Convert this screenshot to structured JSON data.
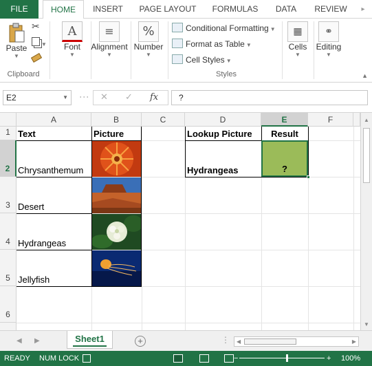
{
  "ribbon_tabs": [
    "FILE",
    "HOME",
    "INSERT",
    "PAGE LAYOUT",
    "FORMULAS",
    "DATA",
    "REVIEW"
  ],
  "ribbon": {
    "clipboard": {
      "paste": "Paste",
      "label": "Clipboard"
    },
    "font": {
      "label": "Font"
    },
    "alignment": {
      "label": "Alignment"
    },
    "number": {
      "label": "Number"
    },
    "styles": {
      "conditional": "Conditional Formatting",
      "format_table": "Format as Table",
      "cell_styles": "Cell Styles",
      "label": "Styles"
    },
    "cells": {
      "label": "Cells"
    },
    "editing": {
      "label": "Editing"
    }
  },
  "formula_bar": {
    "name_box": "E2",
    "content": "?"
  },
  "columns": [
    "A",
    "B",
    "C",
    "D",
    "E",
    "F"
  ],
  "rows": [
    "1",
    "2",
    "3",
    "4",
    "5",
    "6"
  ],
  "cells": {
    "A1": "Text",
    "B1": "Picture",
    "D1": "Lookup Picture",
    "E1": "Result",
    "A2": "Chrysanthemum",
    "D2": "Hydrangeas",
    "E2": "?",
    "A3": "Desert",
    "A4": "Hydrangeas",
    "A5": "Jellyfish"
  },
  "pictures": [
    "chrysanthemum",
    "desert",
    "hydrangeas",
    "jellyfish"
  ],
  "selected_cell": "E2",
  "result_fill_color": "#9bbb59",
  "accent_color": "#217346",
  "sheet_tab": "Sheet1",
  "status": {
    "mode": "READY",
    "num_lock": "NUM LOCK",
    "zoom": "100%"
  }
}
